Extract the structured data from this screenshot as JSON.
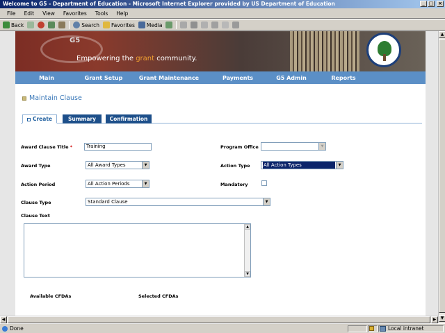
{
  "window": {
    "title": "Welcome to G5 - Department of Education - Microsoft Internet Explorer provided by US Department of Education",
    "min_glyph": "_",
    "max_glyph": "□",
    "close_glyph": "×"
  },
  "menu": [
    "File",
    "Edit",
    "View",
    "Favorites",
    "Tools",
    "Help"
  ],
  "toolbar": {
    "back": "Back",
    "search": "Search",
    "favorites": "Favorites",
    "media": "Media"
  },
  "banner": {
    "logo": "G5",
    "tagline_pre": "Empowering the ",
    "tagline_hl": "grant",
    "tagline_post": " community."
  },
  "nav": [
    "Main",
    "Grant Setup",
    "Grant Maintenance",
    "Payments",
    "G5 Admin",
    "Reports"
  ],
  "section_title": "Maintain Clause",
  "tabs": [
    "Create",
    "Summary",
    "Confirmation"
  ],
  "form": {
    "award_clause_title_label": "Award Clause Title",
    "required_mark": "*",
    "award_clause_title_value": "Training",
    "program_office_label": "Program Office",
    "program_office_value": "",
    "award_type_label": "Award Type",
    "award_type_value": "All Award Types",
    "action_type_label": "Action Type",
    "action_type_value": "All Action Types",
    "action_period_label": "Action Period",
    "action_period_value": "All Action Periods",
    "mandatory_label": "Mandatory",
    "clause_type_label": "Clause Type",
    "clause_type_value": "Standard Clause",
    "clause_text_label": "Clause Text",
    "available_cfdas_label": "Available CFDAs",
    "selected_cfdas_label": "Selected CFDAs"
  },
  "status": {
    "text": "Done",
    "zone": "Local intranet"
  },
  "colors": {
    "nav_bg": "#5b8fc6",
    "tab_active_text": "#2060a0",
    "tab_inactive_bg": "#1d4f8a",
    "title_text": "#3a78b8"
  }
}
